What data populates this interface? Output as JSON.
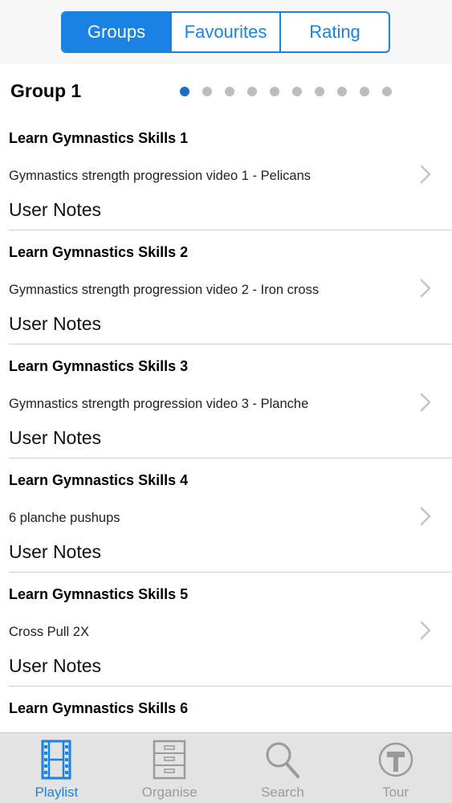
{
  "segmented_control": {
    "options": [
      {
        "label": "Groups",
        "active": true
      },
      {
        "label": "Favourites",
        "active": false
      },
      {
        "label": "Rating",
        "active": false
      }
    ]
  },
  "group": {
    "title": "Group 1",
    "page_count": 10,
    "current_page": 1
  },
  "items": [
    {
      "title": "Learn Gymnastics Skills 1",
      "subtitle": "Gymnastics strength progression video 1 - Pelicans",
      "notes": "User Notes"
    },
    {
      "title": "Learn Gymnastics Skills 2",
      "subtitle": "Gymnastics strength progression video 2 - Iron cross",
      "notes": "User Notes"
    },
    {
      "title": "Learn Gymnastics Skills 3",
      "subtitle": "Gymnastics strength progression video 3 - Planche",
      "notes": "User Notes"
    },
    {
      "title": "Learn Gymnastics Skills 4",
      "subtitle": "6 planche pushups",
      "notes": "User Notes"
    },
    {
      "title": "Learn Gymnastics Skills 5",
      "subtitle": "Cross Pull 2X",
      "notes": "User Notes"
    },
    {
      "title": "Learn Gymnastics Skills 6",
      "subtitle": "",
      "notes": ""
    }
  ],
  "tab_bar": {
    "tabs": [
      {
        "label": "Playlist",
        "icon": "film-strip-icon",
        "active": true
      },
      {
        "label": "Organise",
        "icon": "filing-cabinet-icon",
        "active": false
      },
      {
        "label": "Search",
        "icon": "magnifier-icon",
        "active": false
      },
      {
        "label": "Tour",
        "icon": "tour-sign-icon",
        "active": false
      }
    ]
  },
  "colors": {
    "accent": "#1a82e2",
    "inactive_tab": "#9a9a9a",
    "divider": "#d0d0d0"
  }
}
